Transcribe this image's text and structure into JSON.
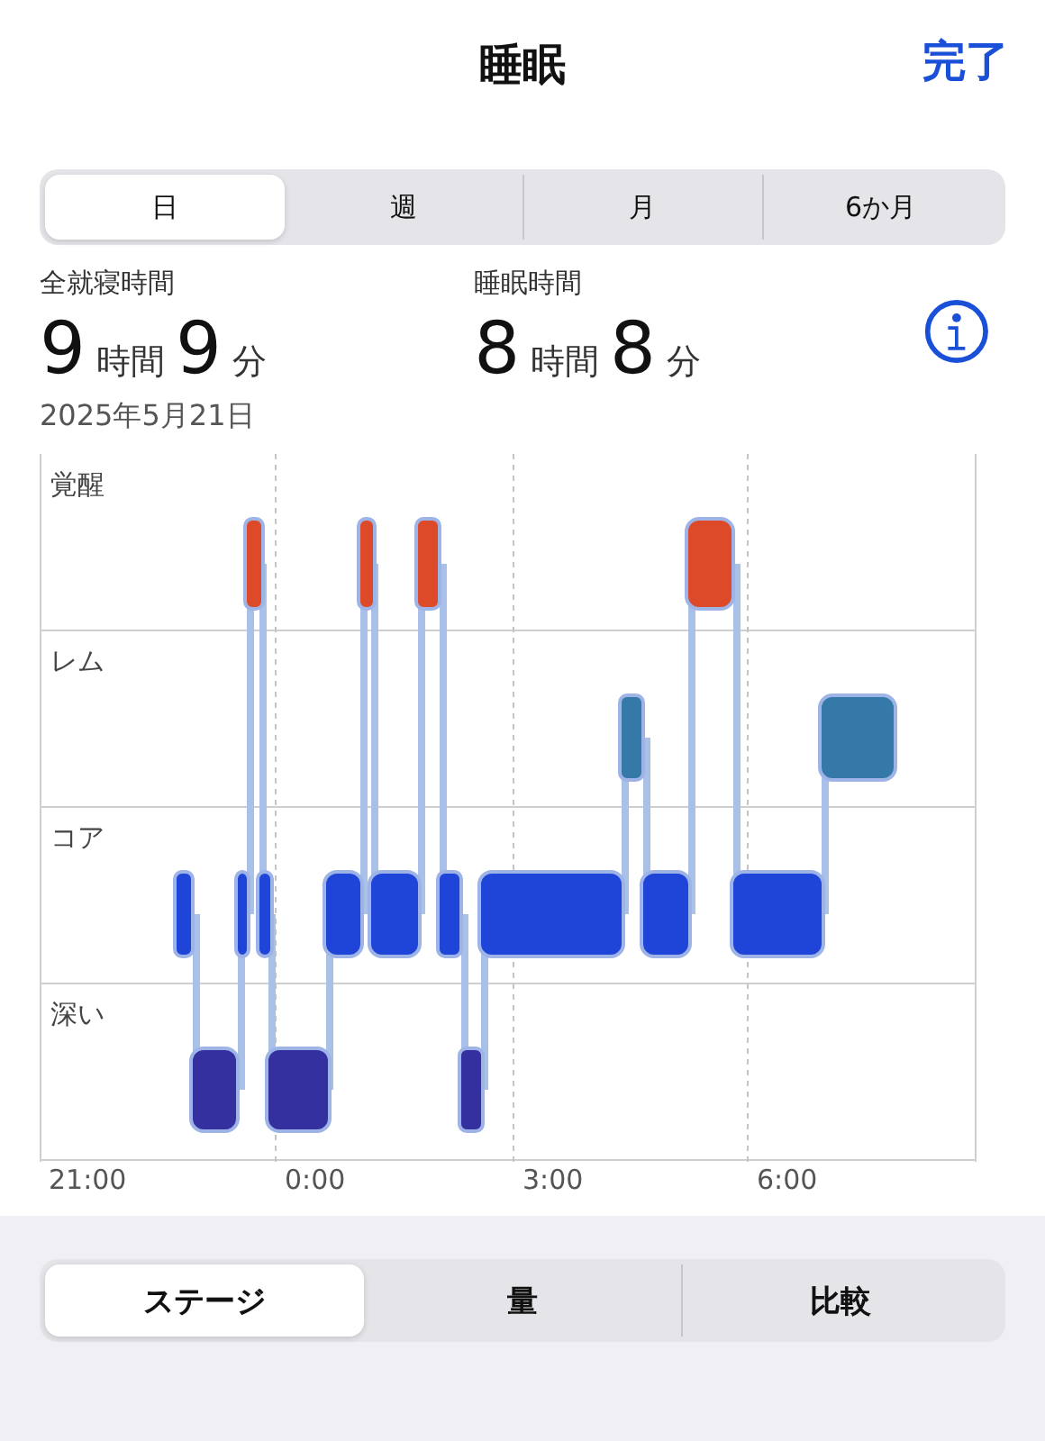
{
  "header": {
    "title": "睡眠",
    "done": "完了"
  },
  "period_tabs": [
    {
      "label": "日",
      "selected": true
    },
    {
      "label": "週",
      "selected": false
    },
    {
      "label": "月",
      "selected": false
    },
    {
      "label": "6か月",
      "selected": false
    }
  ],
  "summary": [
    {
      "label": "全就寝時間",
      "hours": "9",
      "hours_unit": "時間",
      "minutes": "9",
      "minutes_unit": "分"
    },
    {
      "label": "睡眠時間",
      "hours": "8",
      "hours_unit": "時間",
      "minutes": "8",
      "minutes_unit": "分"
    }
  ],
  "date": "2025年5月21日",
  "chart": {
    "stage_labels": [
      "覚醒",
      "レム",
      "コア",
      "深い"
    ],
    "time_labels": [
      "21:00",
      "0:00",
      "3:00",
      "6:00"
    ]
  },
  "view_tabs": [
    {
      "label": "ステージ",
      "selected": true
    },
    {
      "label": "量",
      "selected": false
    },
    {
      "label": "比較",
      "selected": false
    }
  ]
}
